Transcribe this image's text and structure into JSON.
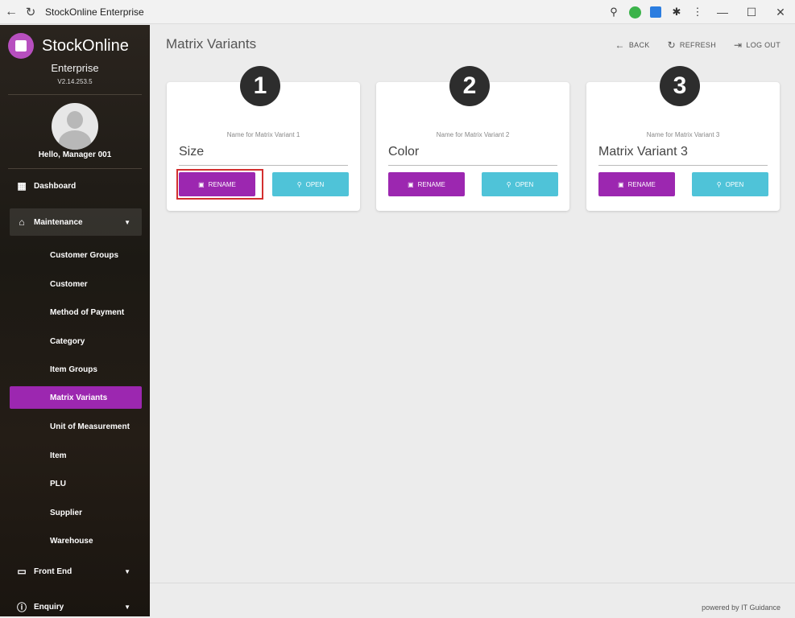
{
  "browser": {
    "title": "StockOnline Enterprise",
    "icons": [
      "back-arrow",
      "reload",
      "zoom",
      "extension-green",
      "extension-blue",
      "extensions-puzzle",
      "menu-kebab"
    ],
    "window_controls": [
      "minimize",
      "maximize",
      "close"
    ]
  },
  "brand": {
    "name": "StockOnline",
    "subtitle": "Enterprise",
    "version": "V2.14.253.5",
    "accent": "#b74fbf"
  },
  "user": {
    "greeting": "Hello, Manager 001"
  },
  "nav": {
    "dashboard": "Dashboard",
    "maintenance": "Maintenance",
    "front_end": "Front End",
    "enquiry": "Enquiry",
    "sub_items": [
      "Customer Groups",
      "Customer",
      "Method of Payment",
      "Category",
      "Item Groups",
      "Matrix Variants",
      "Unit of Measurement",
      "Item",
      "PLU",
      "Supplier",
      "Warehouse"
    ],
    "active": "Matrix Variants"
  },
  "page": {
    "title": "Matrix Variants",
    "back": "BACK",
    "refresh": "REFRESH",
    "logout": "LOG OUT"
  },
  "cards": [
    {
      "badge": "1",
      "label": "Name for Matrix Variant 1",
      "value": "Size",
      "rename": "RENAME",
      "open": "OPEN"
    },
    {
      "badge": "2",
      "label": "Name for Matrix Variant 2",
      "value": "Color",
      "rename": "RENAME",
      "open": "OPEN"
    },
    {
      "badge": "3",
      "label": "Name for Matrix Variant 3",
      "value": "Matrix Variant 3",
      "rename": "RENAME",
      "open": "OPEN"
    }
  ],
  "footer": "powered by IT Guidance",
  "colors": {
    "rename": "#9c27b0",
    "open": "#4fc3d8",
    "highlight": "#d32f2f",
    "active_nav": "#9c27b0"
  }
}
